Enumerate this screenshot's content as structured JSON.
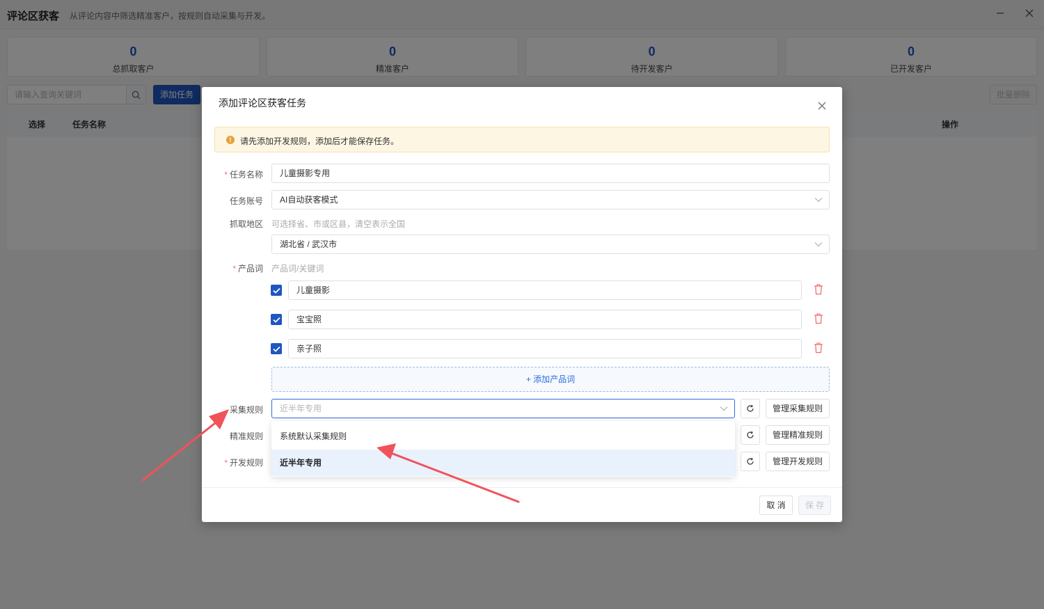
{
  "app": {
    "title": "评论区获客",
    "subtitle": "从评论内容中筛选精准客户，按规则自动采集与开发。",
    "minimize_icon": "minimize-icon",
    "close_icon": "close-icon"
  },
  "stats": [
    {
      "value": "0",
      "label": "总抓取客户"
    },
    {
      "value": "0",
      "label": "精准客户"
    },
    {
      "value": "0",
      "label": "待开发客户"
    },
    {
      "value": "0",
      "label": "已开发客户"
    }
  ],
  "toolbar": {
    "search_placeholder": "请输入查询关键词",
    "add_task_label": "添加任务",
    "batch_delete_label": "批量删除"
  },
  "table": {
    "columns": [
      "选择",
      "任务名称",
      "操作"
    ]
  },
  "dialog": {
    "title": "添加评论区获客任务",
    "alert_text": "请先添加开发规则，添加后才能保存任务。",
    "task_name": {
      "label": "任务名称",
      "value": "儿童摄影专用"
    },
    "task_account": {
      "label": "任务账号",
      "value": "AI自动获客模式"
    },
    "region": {
      "label": "抓取地区",
      "hint": "可选择省、市或区县，清空表示全国",
      "value": "湖北省 / 武汉市"
    },
    "product_words": {
      "label": "产品词",
      "hint": "产品词/关键词",
      "items": [
        {
          "text": "儿童摄影",
          "checked": true
        },
        {
          "text": "宝宝照",
          "checked": true
        },
        {
          "text": "亲子照",
          "checked": true
        }
      ],
      "add_label": "+ 添加产品词"
    },
    "collect_rule": {
      "label": "采集规则",
      "placeholder": "近半年专用",
      "manage_label": "管理采集规则"
    },
    "precise_rule": {
      "label": "精准规则",
      "manage_label": "管理精准规则"
    },
    "develop_rule": {
      "label": "开发规则",
      "manage_label": "管理开发规则"
    },
    "dropdown_options": [
      {
        "label": "系统默认采集规则",
        "selected": false
      },
      {
        "label": "近半年专用",
        "selected": true
      }
    ],
    "cancel_label": "取 消",
    "save_label": "保 存"
  },
  "colors": {
    "primary": "#1e56c2",
    "danger": "#f56c6c",
    "warning": "#e6a23c",
    "annotation_arrow": "#f0525a"
  }
}
